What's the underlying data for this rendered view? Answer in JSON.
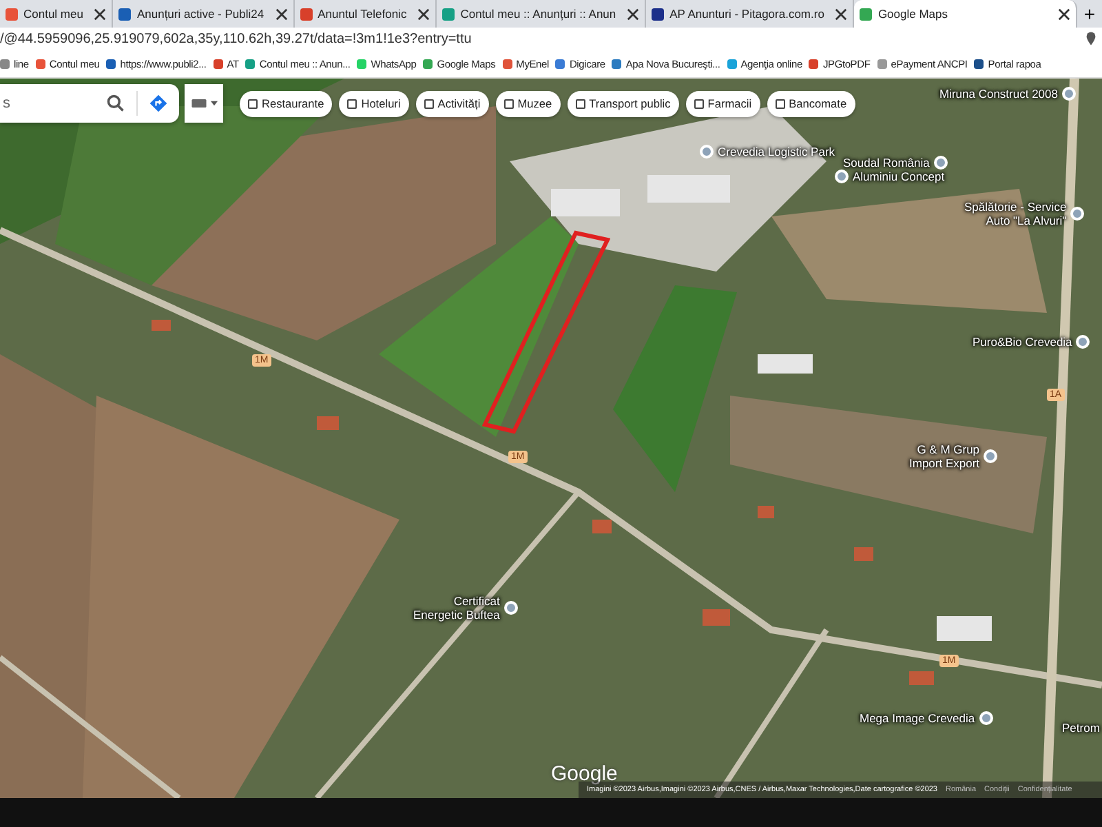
{
  "tabs": [
    {
      "title": "Contul meu",
      "color": "#e8533a",
      "selected": false
    },
    {
      "title": "Anunțuri active - Publi24",
      "color": "#1a5fb4",
      "selected": false
    },
    {
      "title": "Anuntul Telefonic",
      "color": "#d8402a",
      "selected": false
    },
    {
      "title": "Contul meu :: Anunțuri :: Anun",
      "color": "#16a085",
      "selected": false
    },
    {
      "title": "AP Anunturi - Pitagora.com.ro",
      "color": "#1c2f8a",
      "selected": false
    },
    {
      "title": "Google Maps",
      "color": "#34a853",
      "selected": true
    }
  ],
  "new_tab": "+",
  "address": "/@44.5959096,25.919079,602a,35y,110.62h,39.27t/data=!3m1!1e3?entry=ttu",
  "bookmarks": [
    {
      "label": "line",
      "color": "#888888"
    },
    {
      "label": "Contul meu",
      "color": "#e8533a"
    },
    {
      "label": "https://www.publi2...",
      "color": "#1a5fb4"
    },
    {
      "label": "AT",
      "color": "#d8402a"
    },
    {
      "label": "Contul meu :: Anun...",
      "color": "#16a085"
    },
    {
      "label": "WhatsApp",
      "color": "#25d366"
    },
    {
      "label": "Google Maps",
      "color": "#34a853"
    },
    {
      "label": "MyEnel",
      "color": "#e0533a"
    },
    {
      "label": "Digicare",
      "color": "#3a7bd5"
    },
    {
      "label": "Apa Nova Bucureşti...",
      "color": "#2b7bc0"
    },
    {
      "label": "Agenţia online",
      "color": "#1aa3d9"
    },
    {
      "label": "JPGtoPDF",
      "color": "#d8402a"
    },
    {
      "label": "ePayment ANCPI",
      "color": "#999999"
    },
    {
      "label": "Portal rapoa",
      "color": "#1c4f8a"
    }
  ],
  "search": {
    "value": "s"
  },
  "chips": [
    "Restaurante",
    "Hoteluri",
    "Activități",
    "Muzee",
    "Transport public",
    "Farmacii",
    "Bancomate"
  ],
  "places": [
    {
      "lines": [
        "Miruna Construct 2008"
      ]
    },
    {
      "lines": [
        "Crevedia Logistic Park"
      ]
    },
    {
      "lines": [
        "Soudal România"
      ]
    },
    {
      "lines": [
        "Aluminiu Concept"
      ]
    },
    {
      "lines": [
        "Spălătorie - Service",
        "Auto \"La Alvuri\""
      ]
    },
    {
      "lines": [
        "Puro&Bio Crevedia"
      ]
    },
    {
      "lines": [
        "G & M Grup",
        "Import Export"
      ]
    },
    {
      "lines": [
        "Certificat",
        "Energetic Buftea"
      ]
    },
    {
      "lines": [
        "Mega Image Crevedia"
      ]
    },
    {
      "lines": [
        "Petrom"
      ]
    }
  ],
  "road_shields": [
    "1M",
    "1M",
    "1M",
    "1A"
  ],
  "logo": "Google",
  "attribution": "Imagini ©2023 Airbus,Imagini ©2023 Airbus,CNES / Airbus,Maxar Technologies,Date cartografice ©2023",
  "footer_links": [
    "România",
    "Condiții",
    "Confidențialitate"
  ]
}
